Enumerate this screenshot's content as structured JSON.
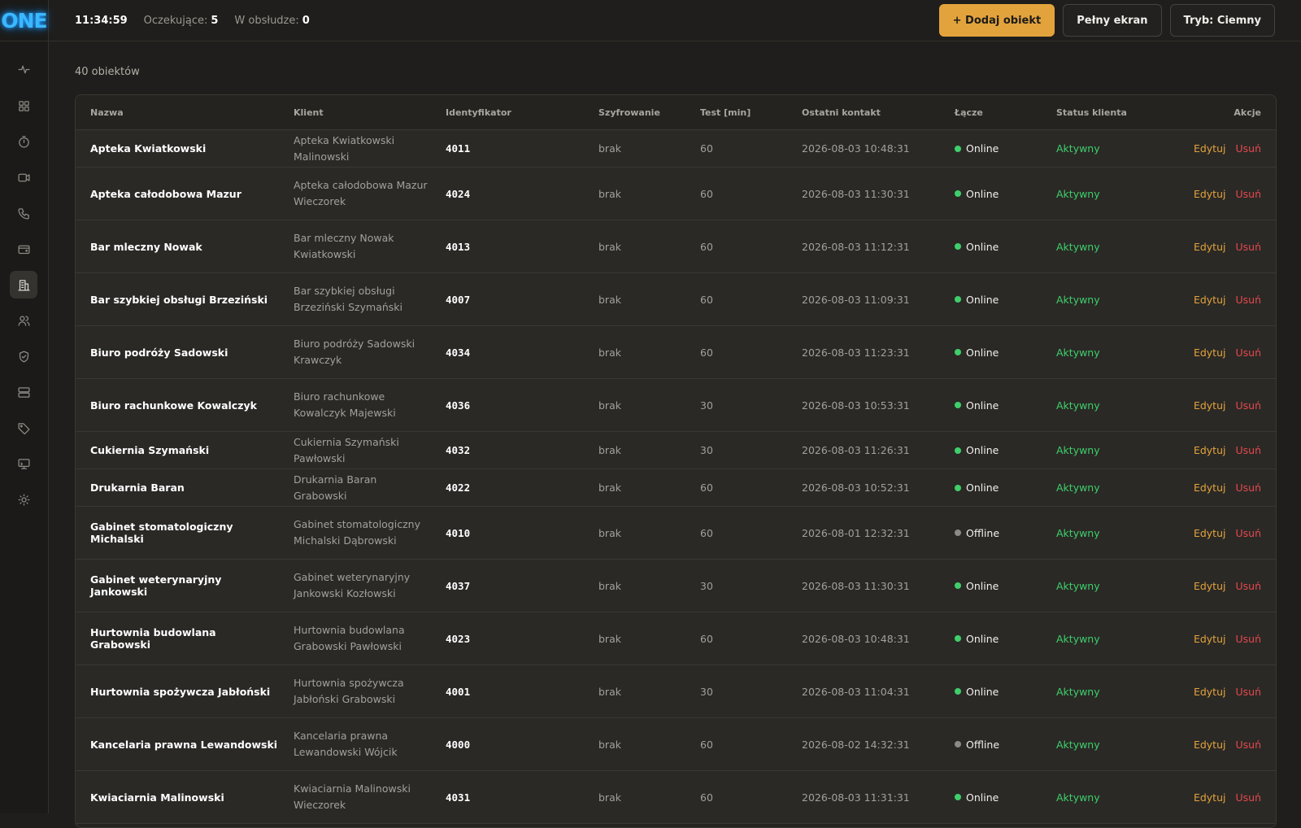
{
  "app": {
    "logo": "ONE"
  },
  "sidebar": {
    "items": [
      {
        "icon": "activity-icon"
      },
      {
        "icon": "dashboard-grid-icon"
      },
      {
        "icon": "timer-icon"
      },
      {
        "icon": "video-camera-icon"
      },
      {
        "icon": "phone-icon"
      },
      {
        "icon": "wallet-icon"
      },
      {
        "icon": "building-objects-icon",
        "active": true
      },
      {
        "icon": "users-icon"
      },
      {
        "icon": "shield-check-icon"
      },
      {
        "icon": "server-icon"
      },
      {
        "icon": "tag-icon"
      },
      {
        "icon": "monitor-icon"
      },
      {
        "icon": "sun-icon"
      }
    ]
  },
  "header": {
    "clock": "11:34:59",
    "pending_label": "Oczekujące:",
    "pending_value": "5",
    "in_service_label": "W obsłudze:",
    "in_service_value": "0",
    "add_button": "+ Dodaj obiekt",
    "fullscreen_button": "Pełny ekran",
    "mode_button": "Tryb: Ciemny"
  },
  "main": {
    "count_text": "40 obiektów",
    "columns": [
      "Nazwa",
      "Klient",
      "Identyfikator",
      "Szyfrowanie",
      "Test [min]",
      "Ostatni kontakt",
      "Łącze",
      "Status klienta",
      "Akcje"
    ],
    "edit_label": "Edytuj",
    "delete_label": "Usuń",
    "rows": [
      {
        "name": "Apteka Kwiatkowski",
        "client": "Apteka Kwiatkowski Malinowski",
        "id": "4011",
        "enc": "brak",
        "test": "60",
        "contact": "2026-08-03 10:48:31",
        "link": "Online",
        "status": "Aktywny"
      },
      {
        "name": "Apteka całodobowa Mazur",
        "client": "Apteka całodobowa Mazur Wieczorek",
        "id": "4024",
        "enc": "brak",
        "test": "60",
        "contact": "2026-08-03 11:30:31",
        "link": "Online",
        "status": "Aktywny"
      },
      {
        "name": "Bar mleczny Nowak",
        "client": "Bar mleczny Nowak Kwiatkowski",
        "id": "4013",
        "enc": "brak",
        "test": "60",
        "contact": "2026-08-03 11:12:31",
        "link": "Online",
        "status": "Aktywny"
      },
      {
        "name": "Bar szybkiej obsługi Brzeziński",
        "client": "Bar szybkiej obsługi Brzeziński Szymański",
        "id": "4007",
        "enc": "brak",
        "test": "60",
        "contact": "2026-08-03 11:09:31",
        "link": "Online",
        "status": "Aktywny"
      },
      {
        "name": "Biuro podróży Sadowski",
        "client": "Biuro podróży Sadowski Krawczyk",
        "id": "4034",
        "enc": "brak",
        "test": "60",
        "contact": "2026-08-03 11:23:31",
        "link": "Online",
        "status": "Aktywny"
      },
      {
        "name": "Biuro rachunkowe Kowalczyk",
        "client": "Biuro rachunkowe Kowalczyk Majewski",
        "id": "4036",
        "enc": "brak",
        "test": "30",
        "contact": "2026-08-03 10:53:31",
        "link": "Online",
        "status": "Aktywny"
      },
      {
        "name": "Cukiernia Szymański",
        "client": "Cukiernia Szymański Pawłowski",
        "id": "4032",
        "enc": "brak",
        "test": "30",
        "contact": "2026-08-03 11:26:31",
        "link": "Online",
        "status": "Aktywny"
      },
      {
        "name": "Drukarnia Baran",
        "client": "Drukarnia Baran Grabowski",
        "id": "4022",
        "enc": "brak",
        "test": "60",
        "contact": "2026-08-03 10:52:31",
        "link": "Online",
        "status": "Aktywny"
      },
      {
        "name": "Gabinet stomatologiczny Michalski",
        "client": "Gabinet stomatologiczny Michalski Dąbrowski",
        "id": "4010",
        "enc": "brak",
        "test": "60",
        "contact": "2026-08-01 12:32:31",
        "link": "Offline",
        "status": "Aktywny"
      },
      {
        "name": "Gabinet weterynaryjny Jankowski",
        "client": "Gabinet weterynaryjny Jankowski Kozłowski",
        "id": "4037",
        "enc": "brak",
        "test": "30",
        "contact": "2026-08-03 11:30:31",
        "link": "Online",
        "status": "Aktywny"
      },
      {
        "name": "Hurtownia budowlana Grabowski",
        "client": "Hurtownia budowlana Grabowski Pawłowski",
        "id": "4023",
        "enc": "brak",
        "test": "60",
        "contact": "2026-08-03 10:48:31",
        "link": "Online",
        "status": "Aktywny"
      },
      {
        "name": "Hurtownia spożywcza Jabłoński",
        "client": "Hurtownia spożywcza Jabłoński Grabowski",
        "id": "4001",
        "enc": "brak",
        "test": "30",
        "contact": "2026-08-03 11:04:31",
        "link": "Online",
        "status": "Aktywny"
      },
      {
        "name": "Kancelaria prawna Lewandowski",
        "client": "Kancelaria prawna Lewandowski Wójcik",
        "id": "4000",
        "enc": "brak",
        "test": "60",
        "contact": "2026-08-02 14:32:31",
        "link": "Offline",
        "status": "Aktywny"
      },
      {
        "name": "Kwiaciarnia Malinowski",
        "client": "Kwiaciarnia Malinowski Wieczorek",
        "id": "4031",
        "enc": "brak",
        "test": "60",
        "contact": "2026-08-03 11:31:31",
        "link": "Online",
        "status": "Aktywny"
      }
    ]
  },
  "colors": {
    "accent": "#e3a33c",
    "online": "#3ecf6a",
    "offline": "#8c8a84",
    "delete": "#e5484d"
  }
}
